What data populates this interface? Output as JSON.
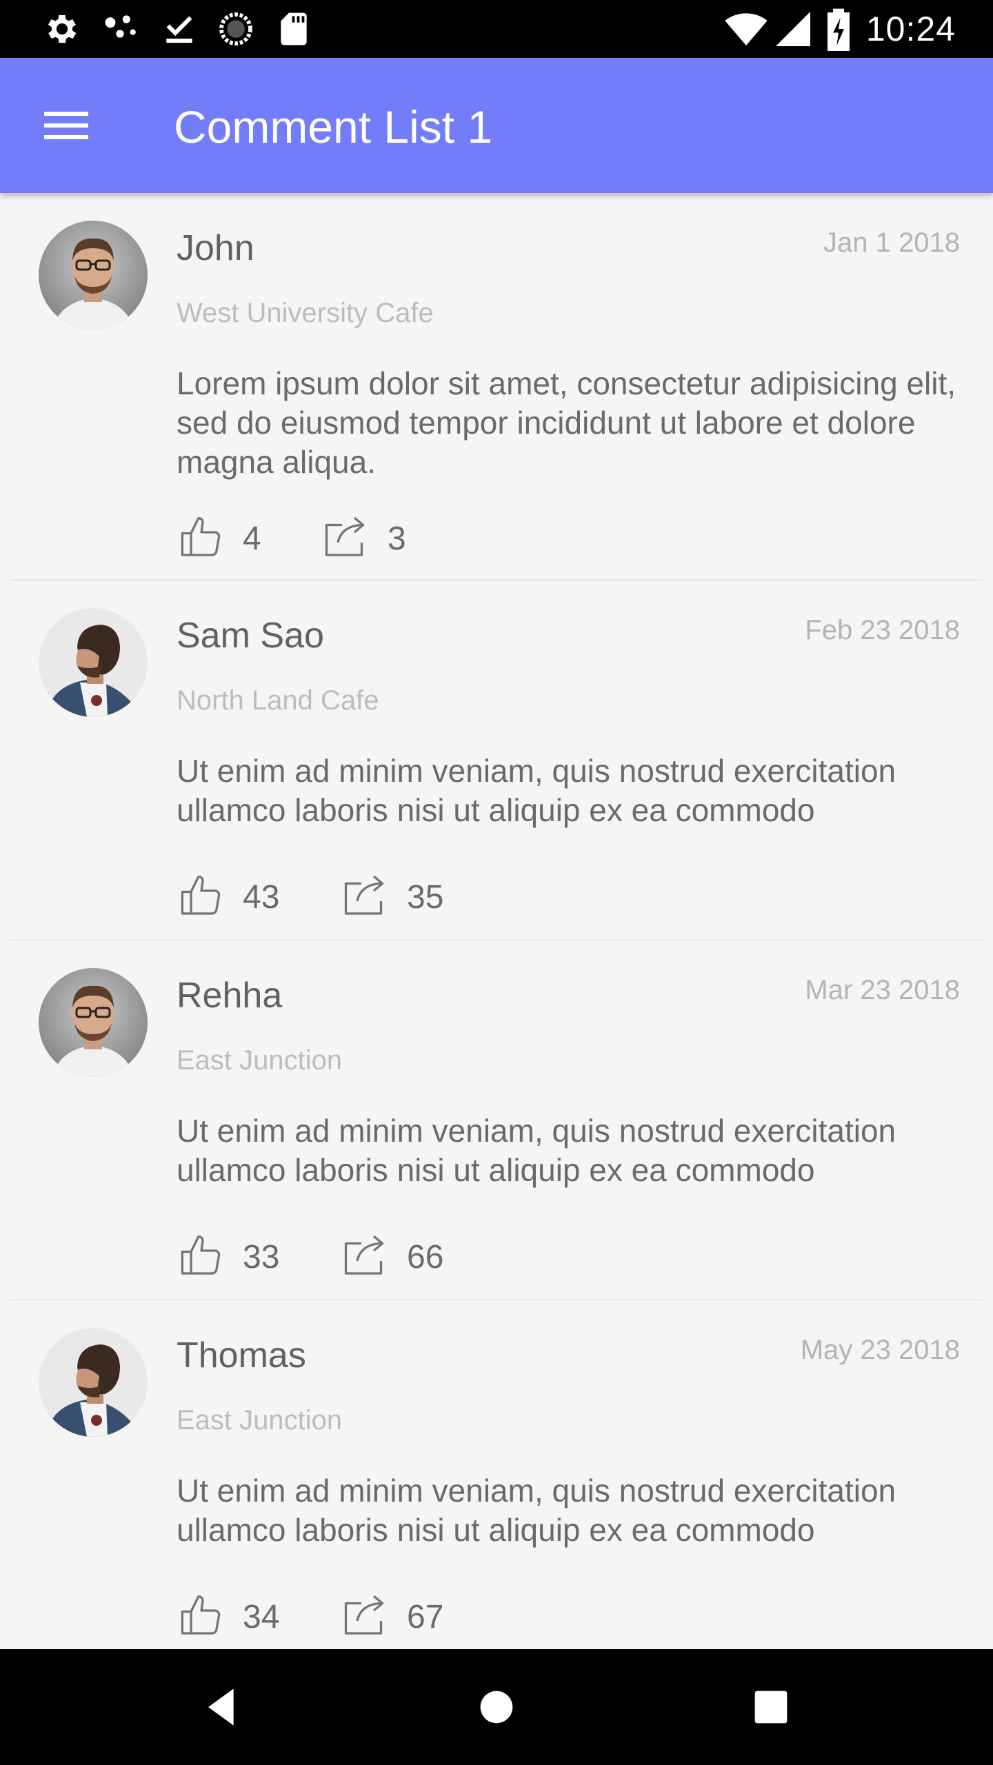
{
  "status_bar": {
    "time": "10:24",
    "left_icons": [
      "settings-icon",
      "dots-icon",
      "download-done-icon",
      "loading-icon",
      "sd-card-icon"
    ],
    "right_icons": [
      "wifi-icon",
      "signal-icon",
      "battery-charging-icon"
    ]
  },
  "app_bar": {
    "title": "Comment List 1",
    "menu_icon": "menu-icon",
    "color": "#737df9"
  },
  "comments": [
    {
      "name": "John",
      "date": "Jan 1 2018",
      "location": "West University Cafe",
      "text": "Lorem ipsum dolor sit amet, consectetur adipisicing elit, sed do eiusmod tempor incididunt ut labore et dolore magna aliqua.",
      "likes": "4",
      "shares": "3",
      "avatar": "avatar-man-glasses"
    },
    {
      "name": "Sam Sao",
      "date": "Feb 23 2018",
      "location": "North Land Cafe",
      "text": "Ut enim ad minim veniam, quis nostrud exercitation ullamco laboris nisi ut aliquip ex ea commodo",
      "likes": "43",
      "shares": "35",
      "avatar": "avatar-man-profile"
    },
    {
      "name": "Rehha",
      "date": "Mar 23 2018",
      "location": "East Junction",
      "text": "Ut enim ad minim veniam, quis nostrud exercitation ullamco laboris nisi ut aliquip ex ea commodo",
      "likes": "33",
      "shares": "66",
      "avatar": "avatar-man-glasses"
    },
    {
      "name": "Thomas",
      "date": "May 23 2018",
      "location": "East Junction",
      "text": "Ut enim ad minim veniam, quis nostrud exercitation ullamco laboris nisi ut aliquip ex ea commodo",
      "likes": "34",
      "shares": "67",
      "avatar": "avatar-man-profile"
    }
  ],
  "nav_bar": {
    "icons": [
      "back-icon",
      "home-icon",
      "recents-icon"
    ]
  }
}
